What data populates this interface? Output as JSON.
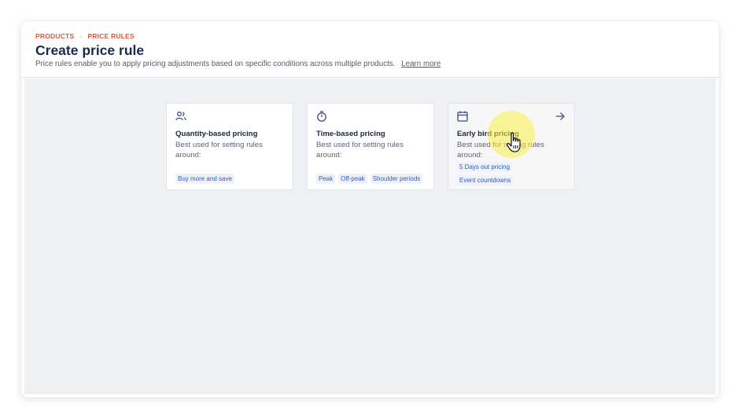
{
  "breadcrumb": {
    "items": [
      "PRODUCTS",
      "PRICE RULES"
    ]
  },
  "header": {
    "title": "Create price rule",
    "subtitle": "Price rules enable you to apply pricing adjustments based on specific conditions across multiple products.",
    "learn_more": "Learn more"
  },
  "cards": [
    {
      "title": "Quantity-based pricing",
      "description": "Best used for setting rules around:",
      "icon": "users-icon",
      "tags": [
        "Buy more and save"
      ]
    },
    {
      "title": "Time-based pricing",
      "description": "Best used for setting rules around:",
      "icon": "stopwatch-icon",
      "tags": [
        "Peak",
        "Off-peak",
        "Shoulder periods"
      ]
    },
    {
      "title": "Early bird pricing",
      "description": "Best used for setting rules around:",
      "icon": "calendar-icon",
      "tags": [
        "5 Days out pricing",
        "Event countdowns"
      ]
    }
  ],
  "colors": {
    "accent": "#e2553a",
    "title": "#1b2a52",
    "tag_text": "#2f5bb7",
    "tag_bg": "#eef2fb",
    "content_bg": "#eff0f3"
  }
}
